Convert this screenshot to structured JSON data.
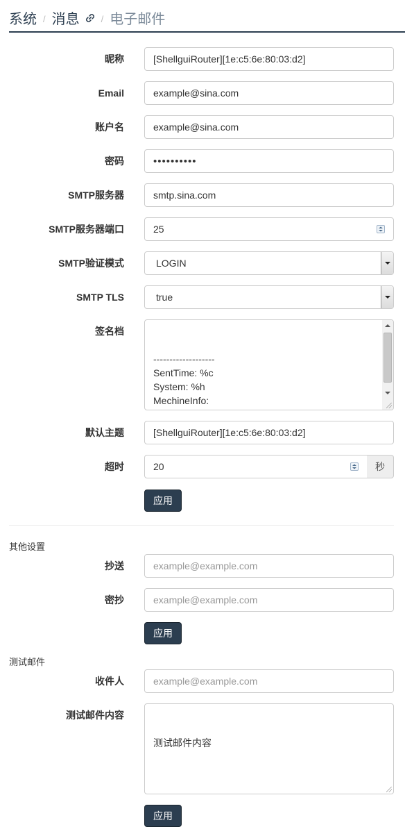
{
  "breadcrumb": {
    "items": [
      "系统",
      "消息",
      "电子邮件"
    ],
    "separator": "/"
  },
  "form": {
    "nickname": {
      "label": "昵称",
      "value": "[ShellguiRouter][1e:c5:6e:80:03:d2]"
    },
    "email": {
      "label": "Email",
      "value": "example@sina.com"
    },
    "account": {
      "label": "账户名",
      "value": "example@sina.com"
    },
    "password": {
      "label": "密码",
      "value": "••••••••••"
    },
    "smtp_server": {
      "label": "SMTP服务器",
      "value": "smtp.sina.com"
    },
    "smtp_port": {
      "label": "SMTP服务器端口",
      "value": "25"
    },
    "smtp_auth": {
      "label": "SMTP验证模式",
      "value": "LOGIN"
    },
    "smtp_tls": {
      "label": "SMTP TLS",
      "value": "true"
    },
    "signature": {
      "label": "签名档",
      "value": "-------------------\nSentTime: %c\nSystem: %h\nMechineInfo:\n%f"
    },
    "default_subject": {
      "label": "默认主题",
      "value": "[ShellguiRouter][1e:c5:6e:80:03:d2]"
    },
    "timeout": {
      "label": "超时",
      "value": "20",
      "unit": "秒"
    },
    "apply_label": "应用"
  },
  "other_settings": {
    "title": "其他设置",
    "cc": {
      "label": "抄送",
      "placeholder": "example@example.com"
    },
    "bcc": {
      "label": "密抄",
      "placeholder": "example@example.com"
    },
    "apply_label": "应用"
  },
  "test_mail": {
    "title": "测试邮件",
    "recipient": {
      "label": "收件人",
      "placeholder": "example@example.com"
    },
    "content": {
      "label": "测试邮件内容",
      "value": "测试邮件内容"
    },
    "apply_label": "应用"
  },
  "colors": {
    "primary": "#2c3e50",
    "border": "#cccccc",
    "placeholder": "#999999"
  }
}
